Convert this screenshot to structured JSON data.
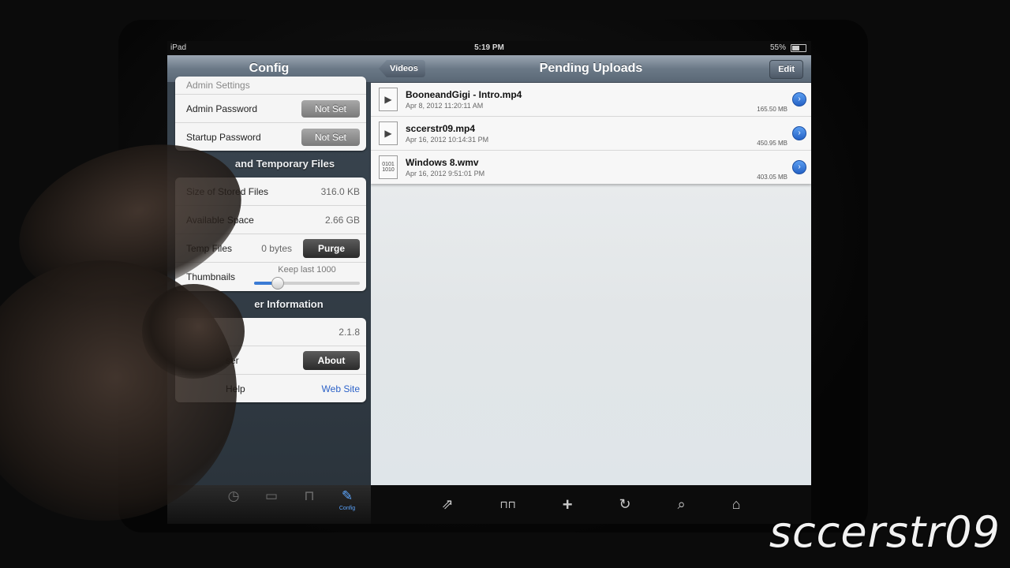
{
  "status_bar": {
    "device": "iPad",
    "time": "5:19 PM",
    "battery": "55%",
    "battery_fraction": 0.55
  },
  "master": {
    "title": "Config",
    "cut_off_row": "Admin Settings",
    "passwords": [
      {
        "label": "Admin Password",
        "button": "Not Set"
      },
      {
        "label": "Startup Password",
        "button": "Not Set"
      }
    ],
    "storage": {
      "title": "and Temporary Files",
      "stored_label": "Size of Stored Files",
      "stored_value": "316.0 KB",
      "available_label": "Available Space",
      "available_value": "2.66 GB",
      "temp_label": "Temp Files",
      "temp_value": "0 bytes",
      "purge_button": "Purge",
      "thumbs_label": "Thumbnails",
      "thumbs_caption": "Keep last 1000",
      "thumbs_level": 0.22
    },
    "info": {
      "title": "er Information",
      "version_value": "2.1.8",
      "about_label": "ser",
      "about_button": "About",
      "help_label": "Help",
      "help_link": "Web Site"
    }
  },
  "tabs": [
    {
      "icon": "clock-icon",
      "glyph": "◷",
      "label": ""
    },
    {
      "icon": "book-icon",
      "glyph": "▭",
      "label": ""
    },
    {
      "icon": "bookmarks-icon",
      "glyph": "⊓",
      "label": ""
    },
    {
      "icon": "wrench-icon",
      "glyph": "✎",
      "label": "Config"
    }
  ],
  "detail": {
    "title": "Pending Uploads",
    "back_button": "Videos",
    "edit_button": "Edit",
    "uploads": [
      {
        "name": "BooneandGigi - Intro.mp4",
        "date": "Apr 8, 2012 11:20:11 AM",
        "size": "165.50 MB"
      },
      {
        "name": "sccerstr09.mp4",
        "date": "Apr 16, 2012 10:14:31 PM",
        "size": "450.95 MB"
      },
      {
        "name": "Windows 8.wmv",
        "date": "Apr 16, 2012 9:51:01 PM",
        "size": "403.05 MB"
      }
    ]
  },
  "toolbar": [
    {
      "icon": "share-icon",
      "glyph": "⇗"
    },
    {
      "icon": "book-open-icon",
      "glyph": "⊓⊓"
    },
    {
      "icon": "add-icon",
      "glyph": "+"
    },
    {
      "icon": "refresh-icon",
      "glyph": "↻"
    },
    {
      "icon": "search-icon",
      "glyph": "⌕"
    },
    {
      "icon": "home-icon",
      "glyph": "⌂"
    }
  ],
  "watermark": "sccerstr09",
  "colors": {
    "accent": "#2d62c7",
    "navbar": "#6b7987",
    "config_tab": "#5ea7ff"
  }
}
